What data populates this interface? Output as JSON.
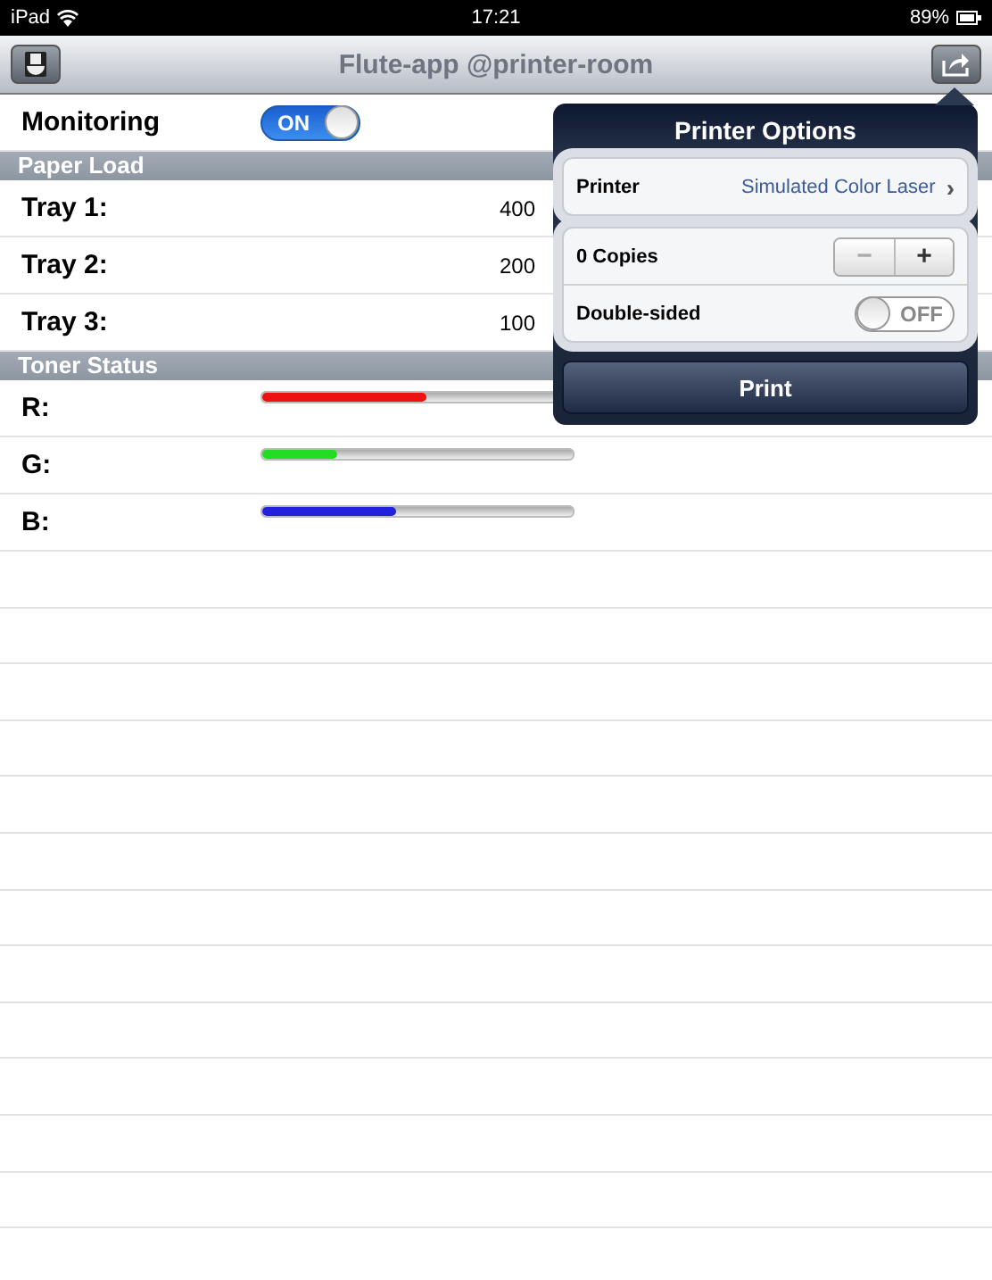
{
  "status_bar": {
    "device": "iPad",
    "time": "17:21",
    "battery": "89%"
  },
  "nav_bar": {
    "title": "Flute-app @printer-room"
  },
  "monitoring": {
    "label": "Monitoring",
    "on": true,
    "text": "ON"
  },
  "sections": [
    {
      "title": "Paper Load",
      "kind": "values",
      "rows": [
        {
          "label": "Tray 1:",
          "value": "400"
        },
        {
          "label": "Tray 2:",
          "value": "200"
        },
        {
          "label": "Tray 3:",
          "value": "100"
        }
      ]
    },
    {
      "title": "Toner Status",
      "kind": "levels",
      "rows": [
        {
          "label": "R:",
          "level": 0.53,
          "color": "#ee1111"
        },
        {
          "label": "G:",
          "level": 0.24,
          "color": "#22dd22"
        },
        {
          "label": "B:",
          "level": 0.43,
          "color": "#2222dd"
        }
      ]
    }
  ],
  "popover": {
    "title": "Printer Options",
    "printer_label": "Printer",
    "printer_value": "Simulated Color Laser",
    "chevron": "›",
    "copies": "0 Copies",
    "minus": "−",
    "plus": "+",
    "minus_disabled": true,
    "double_sided": {
      "label": "Double-sided",
      "on": false,
      "text": "OFF"
    },
    "print": "Print"
  }
}
